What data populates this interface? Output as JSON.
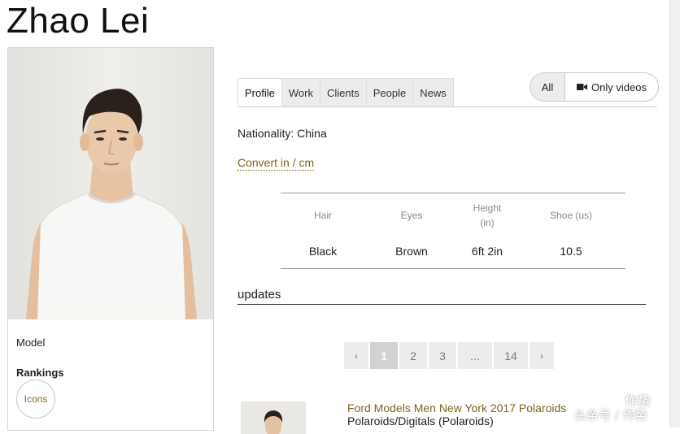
{
  "page": {
    "model_name": "Zhao Lei"
  },
  "profile": {
    "category": "Model",
    "rankings_heading": "Rankings",
    "ranking_badge": "Icons"
  },
  "tabs": [
    {
      "label": "Profile",
      "active": true
    },
    {
      "label": "Work",
      "active": false
    },
    {
      "label": "Clients",
      "active": false
    },
    {
      "label": "People",
      "active": false
    },
    {
      "label": "News",
      "active": false
    }
  ],
  "media_filter": {
    "all_label": "All",
    "videos_label": "Only videos",
    "videos_icon": "video-camera-icon"
  },
  "details": {
    "nationality": "Nationality: China",
    "convert_link": "Convert in / cm"
  },
  "measurements": {
    "headers": [
      "Hair",
      "Eyes",
      "Height",
      "Shoe (us)"
    ],
    "height_sub": "(in)",
    "values": [
      "Black",
      "Brown",
      "6ft 2in",
      "10.5"
    ]
  },
  "updates": {
    "heading": "updates",
    "pagination": [
      "‹",
      "1",
      "2",
      "3",
      "...",
      "14",
      "›"
    ],
    "current_page": "1",
    "items": [
      {
        "title": "Ford Models Men New York 2017 Polaroids",
        "subtitle": "Polaroids/Digitals (Polaroids)"
      }
    ]
  },
  "watermark": {
    "line1": "作势",
    "line2": "头条号 / 作势"
  },
  "colors": {
    "link": "#7e6420",
    "tab_inactive": "#ececec",
    "pager_current": "#d2d2d2"
  }
}
